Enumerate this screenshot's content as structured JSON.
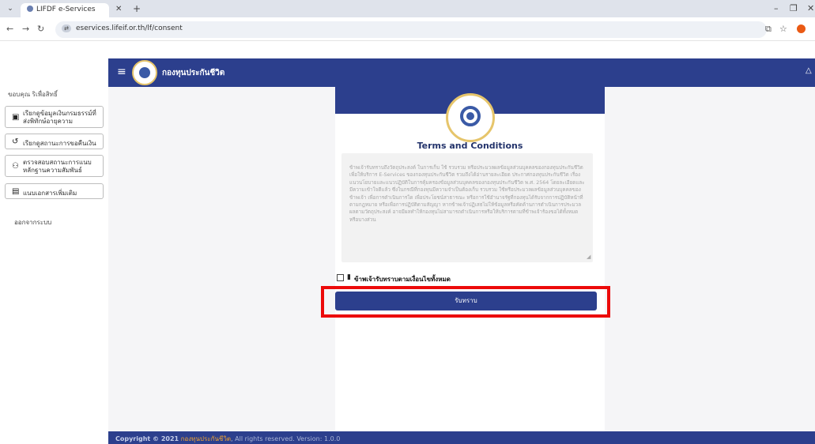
{
  "browser": {
    "tab_title": "LIFDF e-Services",
    "url": "eservices.lifeif.or.th/lf/consent"
  },
  "header": {
    "brand": "กองทุนประกันชีวิต"
  },
  "sidebar": {
    "heading": "ขอบคุณ ริเพื่อสิทธิ์",
    "items": [
      {
        "label": "เรียกดูข้อมูลเงินกรมธรรม์ที่ส่งพิทักษ์อายุความ",
        "icon": "document-icon"
      },
      {
        "label": "เรียกดูสถานะการขอคืนเงิน",
        "icon": "history-icon"
      },
      {
        "label": "ตรวจสอบสถานะการแนบหลักฐานความสัมพันธ์",
        "icon": "people-icon"
      },
      {
        "label": "แนบเอกสารเพิ่มเติม",
        "icon": "add-document-icon"
      }
    ],
    "logout": "ออกจากระบบ"
  },
  "card": {
    "title": "Terms and Conditions",
    "terms_text": "ข้าพเจ้ารับทราบถึงวัตถุประสงค์ ในการเก็บ ใช้ รวบรวม หรือประมวลผลข้อมูลส่วนบุคคลของกองทุนประกันชีวิต เพื่อให้บริการ E-Services ของกองทุนประกันชีวิต รวมถึงได้อ่านรายละเอียด ประกาศกองทุนประกันชีวิต เรื่อง แนวนโยบายและแนวปฏิบัติในการคุ้มครองข้อมูลส่วนบุคคลของกองทุนประกันชีวิต พ.ศ. 2564 โดยละเอียดและมีความเข้าใจดีแล้ว ซึ่งในกรณีที่กองทุนมีความจำเป็นต้องเก็บ รวบรวม ใช้หรือประมวลผลข้อมูลส่วนบุคคลของข้าพเจ้า เพื่อการดำเนินการใด เพื่อประโยชน์สาธารณะ หรือการใช้อำนาจรัฐที่กองทุนได้รับจากการปฏิบัติหน้าที่ตามกฎหมาย หรือเพื่อการปฏิบัติตามสัญญา หากข้าพเจ้าปฏิเสธไม่ให้ข้อมูลหรือคัดค้านการดำเนินการประมวลผลตามวัตถุประสงค์ อาจมีผลทำให้กองทุนไม่สามารถดำเนินการหรือให้บริการตามที่ข้าพเจ้าร้องขอได้ทั้งหมดหรือบางส่วน",
    "consent_label": "ข้าพเจ้ารับทราบตามเงื่อนไขทั้งหมด",
    "accept_label": "รับทราบ"
  },
  "footer": {
    "copyright": "Copyright © 2021",
    "org": "กองทุนประกันชีวิต",
    "rest": ", All rights reserved. Version: 1.0.0"
  }
}
